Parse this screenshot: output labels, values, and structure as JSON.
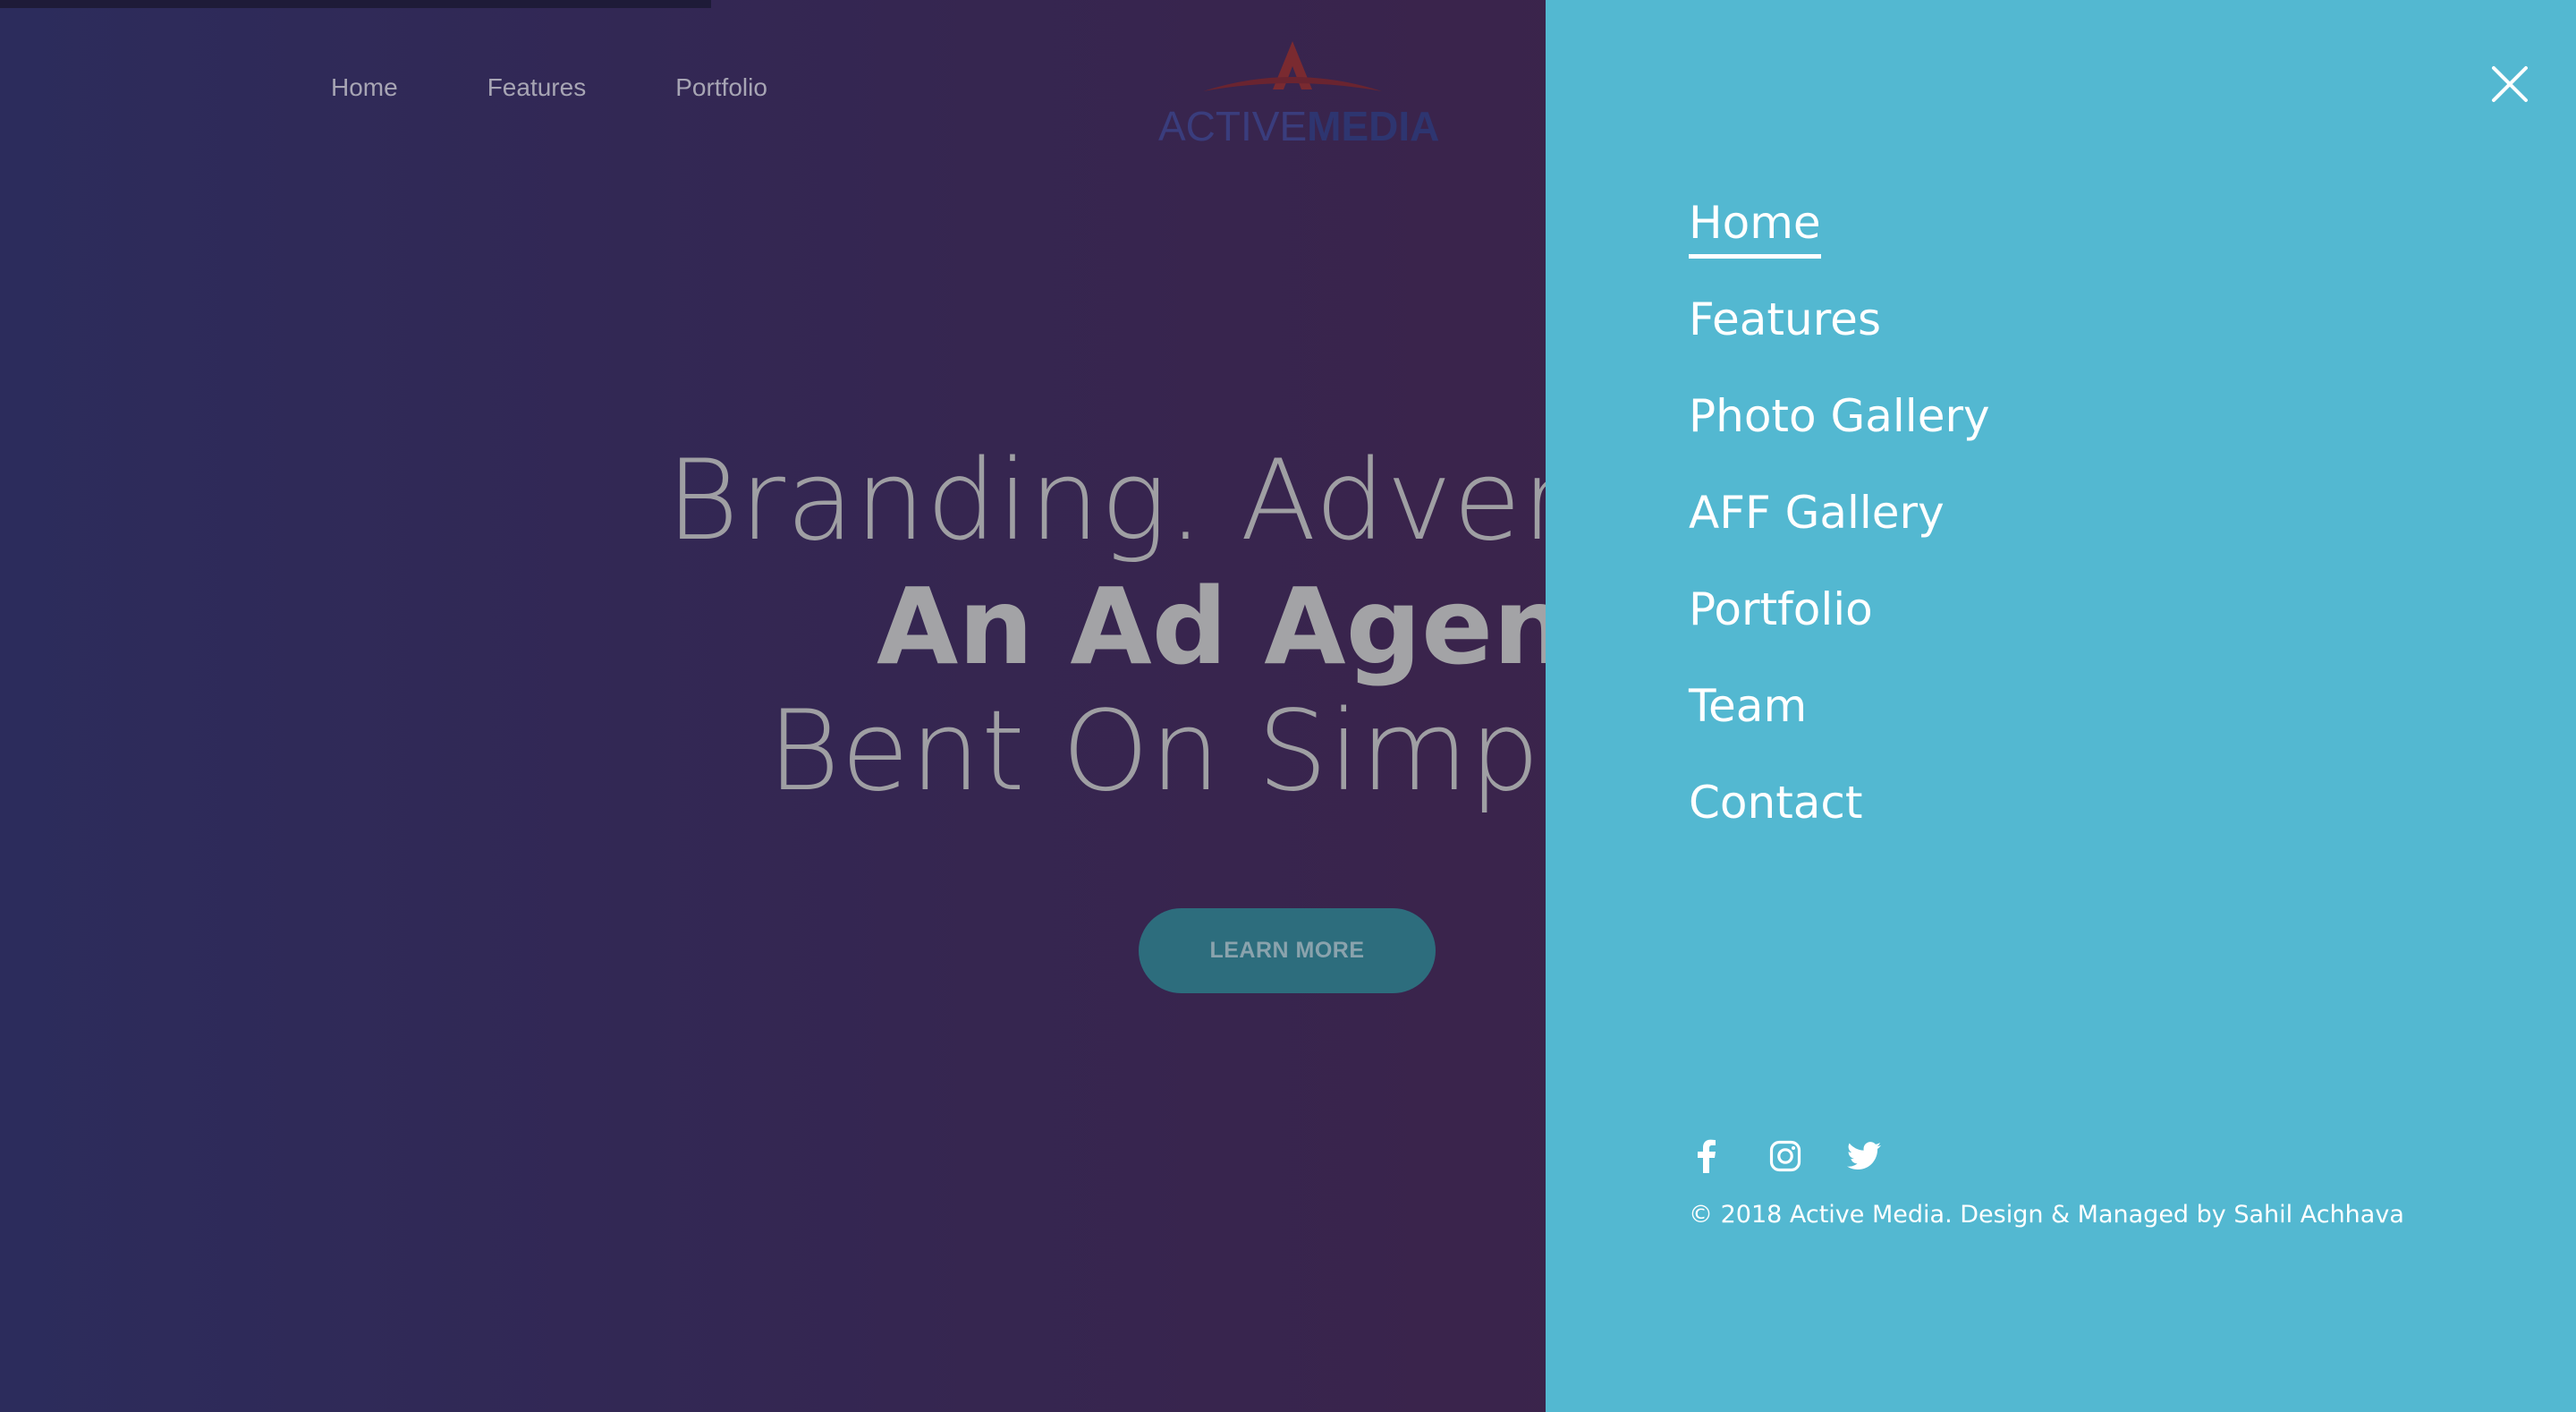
{
  "colors": {
    "menu_bg": "#53b8d1",
    "hero_bg_left": "#2c2c5c",
    "hero_bg_right": "#441f42",
    "button_bg": "#2d6d7d",
    "logo_red": "#8a2a2a",
    "logo_blue": "#2e3570"
  },
  "topnav": {
    "items": [
      {
        "label": "Home"
      },
      {
        "label": "Features"
      },
      {
        "label": "Portfolio"
      }
    ]
  },
  "logo": {
    "part1": "ACTIVE",
    "part2": "MEDIA"
  },
  "hero": {
    "line1": "Branding. Advertising.",
    "line2": "An Ad Agency",
    "line3": "Bent On Simplicity",
    "button_label": "LEARN MORE"
  },
  "menu": {
    "close_icon": "close-icon",
    "items": [
      {
        "label": "Home",
        "active": true
      },
      {
        "label": "Features"
      },
      {
        "label": "Photo Gallery"
      },
      {
        "label": "AFF Gallery"
      },
      {
        "label": "Portfolio"
      },
      {
        "label": "Team"
      },
      {
        "label": "Contact"
      }
    ],
    "social": [
      "facebook-icon",
      "instagram-icon",
      "twitter-icon"
    ],
    "copyright": "© 2018 Active Media. Design & Managed by Sahil Achhava"
  }
}
